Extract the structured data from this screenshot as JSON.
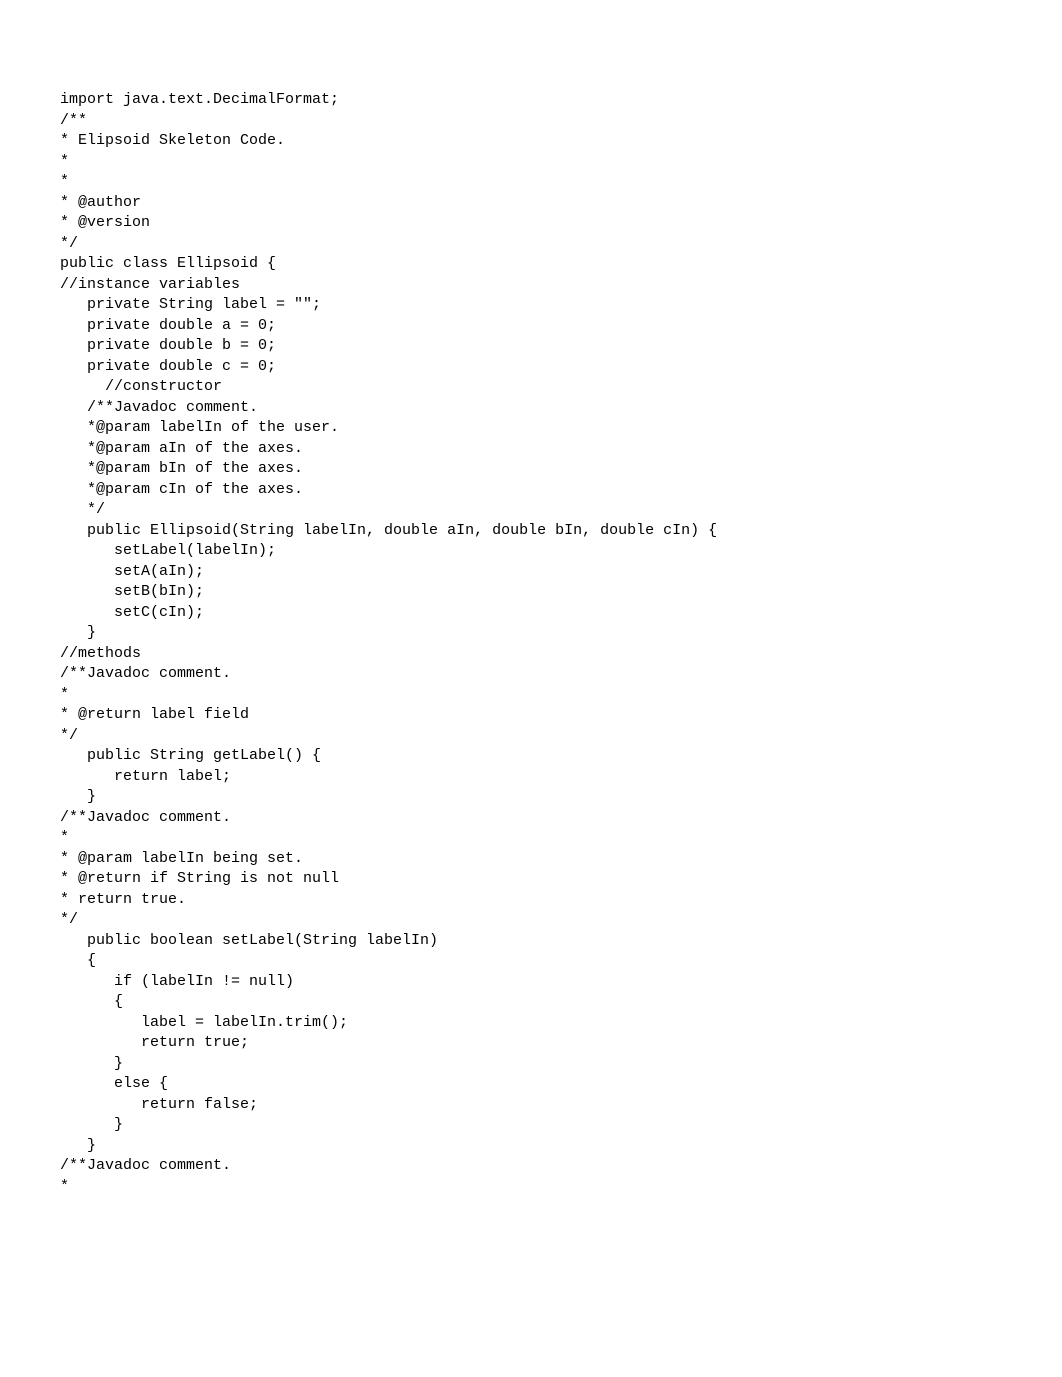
{
  "code": {
    "lines": [
      "import java.text.DecimalFormat;",
      "/**",
      "* Elipsoid Skeleton Code.",
      "*",
      "*",
      "* @author",
      "* @version",
      "*/",
      "public class Ellipsoid {",
      "//instance variables",
      "",
      "   private String label = \"\";",
      "   private double a = 0;",
      "   private double b = 0;",
      "   private double c = 0;",
      "     //constructor",
      "",
      "   /**Javadoc comment.",
      "   *@param labelIn of the user.",
      "   *@param aIn of the axes.",
      "   *@param bIn of the axes.",
      "   *@param cIn of the axes.",
      "   */",
      "",
      "   public Ellipsoid(String labelIn, double aIn, double bIn, double cIn) {",
      "      setLabel(labelIn);",
      "      setA(aIn);",
      "      setB(bIn);",
      "      setC(cIn);",
      "   }",
      "//methods",
      "/**Javadoc comment.",
      "*",
      "* @return label field",
      "*/",
      "   public String getLabel() {",
      "      return label;",
      "   }",
      "",
      "/**Javadoc comment.",
      "*",
      "* @param labelIn being set.",
      "* @return if String is not null",
      "* return true.",
      "*/",
      "   public boolean setLabel(String labelIn)",
      "   {",
      "      if (labelIn != null)",
      "      {",
      "         label = labelIn.trim();",
      "         return true;",
      "      }",
      "      else {",
      "         return false;",
      "      }",
      "   }",
      "",
      "/**Javadoc comment.",
      "*"
    ]
  }
}
